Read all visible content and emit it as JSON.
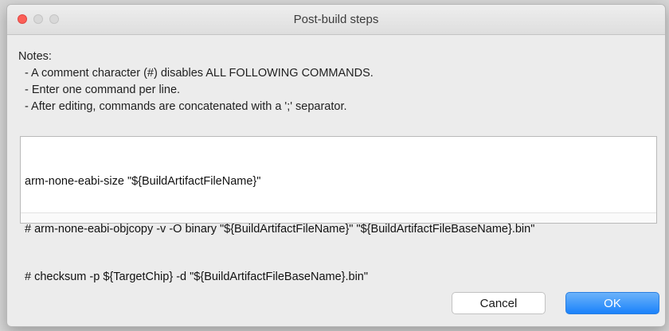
{
  "window": {
    "title": "Post-build steps",
    "controls": {
      "close_color": "#fc5f57",
      "inactive_color": "#d8d8d8"
    }
  },
  "notes": {
    "heading": "Notes:",
    "items": [
      "- A comment character (#) disables ALL FOLLOWING COMMANDS.",
      "- Enter one command per line.",
      "- After editing, commands are concatenated with a ';' separator."
    ]
  },
  "editor": {
    "lines": [
      "arm-none-eabi-size \"${BuildArtifactFileName}\"",
      "# arm-none-eabi-objcopy -v -O binary \"${BuildArtifactFileName}\" \"${BuildArtifactFileBaseName}.bin\"",
      "# checksum -p ${TargetChip} -d \"${BuildArtifactFileBaseName}.bin\""
    ]
  },
  "buttons": {
    "cancel_label": "Cancel",
    "ok_label": "OK",
    "ok_color": "#1a82fb"
  }
}
